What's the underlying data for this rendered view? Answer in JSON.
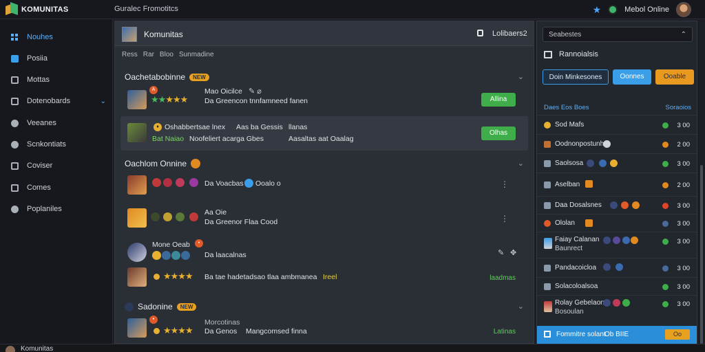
{
  "app": {
    "name": "KOMUNITAS"
  },
  "topbar": {
    "crumb": "Guralec Fromotitcs",
    "user_name": "Mebol Online"
  },
  "sidebar": {
    "items": [
      {
        "label": "Nouhes",
        "icon": "grid-icon"
      },
      {
        "label": "Posiia",
        "icon": "post-icon"
      },
      {
        "label": "Mottas",
        "icon": "people-icon"
      },
      {
        "label": "Dotenobards",
        "icon": "board-icon"
      },
      {
        "label": "Veeanes",
        "icon": "chat-icon"
      },
      {
        "label": "Scnkontiats",
        "icon": "settings-icon"
      },
      {
        "label": "Coviser",
        "icon": "edit-icon"
      },
      {
        "label": "Comes",
        "icon": "list-icon"
      },
      {
        "label": "Poplaniles",
        "icon": "globe-icon"
      }
    ]
  },
  "main": {
    "title": "Komunitas",
    "action": "Lolibaers2",
    "tabs": [
      "Ress",
      "Rar",
      "Bloo",
      "Sunmadine"
    ],
    "sections": [
      {
        "title": "Oachetabobinne",
        "badge": "NEW",
        "rows": [
          {
            "name": "Mao Oicilce",
            "line": "Da Greencon tnnfamneed fanen",
            "button": "Allina"
          },
          {
            "name": "Oshabbertsae lnex",
            "extra": "Aas ba Gessis",
            "extra2": "llanas",
            "line": "Bat Naiao",
            "line2": "Noofeliert acarga Gbes",
            "line3": "Aasaltas aat Oaalag",
            "button": "Olhas"
          }
        ]
      },
      {
        "title": "Oachlom Onnine",
        "rows": [
          {
            "line": "Da Voacbas",
            "extra": "Ooalo o"
          },
          {
            "name": "Aa Oie",
            "line": "Da Greenor Flaa Cood"
          },
          {
            "name": "Mone Oeab",
            "line": "Da laacalnas"
          },
          {
            "line": "Ba tae hadetadsao tlaa ambmanea",
            "extra": "Ireel",
            "status": "laadmas"
          }
        ]
      },
      {
        "title": "Sadonine",
        "badge": "NEW",
        "rows": [
          {
            "name": "Morcotinas",
            "line": "Da Genos",
            "line2": "Mangcomsed finna",
            "status": "Latinas"
          }
        ]
      }
    ]
  },
  "right": {
    "search": "Seabestes",
    "title": "Rannoialsis",
    "buttons": [
      "Doin Minkesones",
      "Oonnes",
      "Ooable"
    ],
    "col_left": "Daes Eos Boes",
    "col_right": "Soraoios",
    "rows": [
      {
        "name": "Sod Mafs",
        "value": "3 00",
        "dot": "#3fae4a"
      },
      {
        "name": "Oodnonpostunh",
        "value": "2 00",
        "dot": "#e08a20"
      },
      {
        "name": "Saolsosa",
        "value": "3 00",
        "dot": "#3fae4a"
      },
      {
        "name": "Aselban",
        "value": "2 00",
        "dot": "#e08a20"
      },
      {
        "name": "Daa Dosalsnes",
        "value": "3 00",
        "dot": "#e0452a"
      },
      {
        "name": "Ololan",
        "value": "3 00",
        "dot": "#4a6a9a"
      },
      {
        "name": "Faiay Calanan",
        "sub": "Baunrect",
        "value": "3 00",
        "dot": "#3fae4a"
      },
      {
        "name": "Pandacoicloa",
        "value": "3 00",
        "dot": "#4a6a9a"
      },
      {
        "name": "Solacoloalsoa",
        "value": "3 00",
        "dot": "#3fae4a"
      },
      {
        "name": "Rolay Gebelaon",
        "sub": "Bosoulan",
        "value": "3 00",
        "dot": "#3fae4a"
      }
    ],
    "footer": {
      "text": "Fommitre solant",
      "value": "Ob BIIE",
      "button": "Oo"
    }
  },
  "bottombar": {
    "text": "Komunitas"
  },
  "colors": {
    "accent": "#3a9ee8",
    "success": "#3fae4a",
    "warning": "#e89a20"
  }
}
